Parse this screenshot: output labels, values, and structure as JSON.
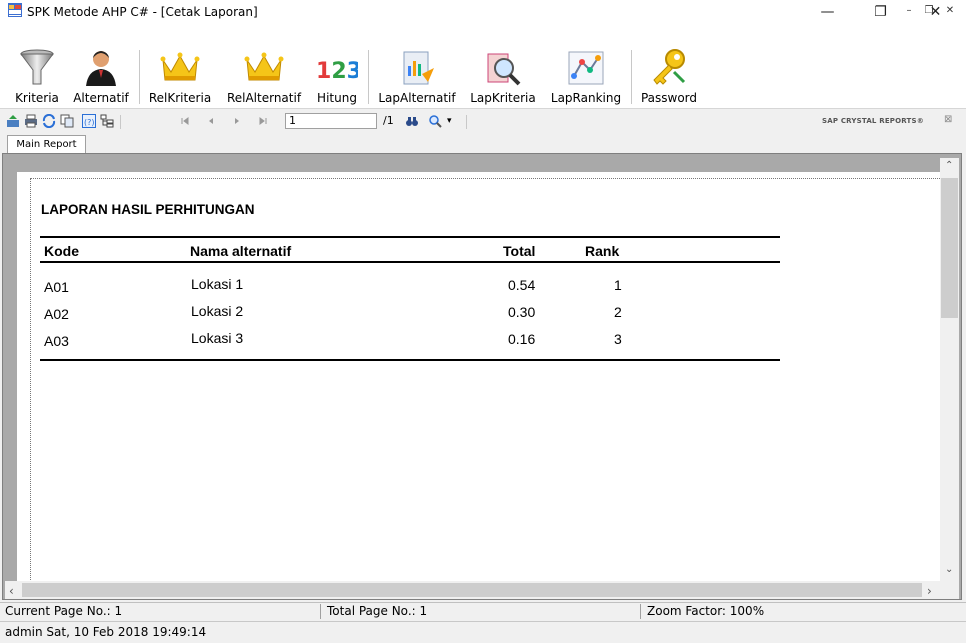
{
  "window": {
    "title": "SPK Metode AHP C# - [Cetak Laporan]"
  },
  "toolbar": {
    "items": [
      {
        "label": "Kriteria"
      },
      {
        "label": "Alternatif"
      },
      {
        "label": "RelKriteria"
      },
      {
        "label": "RelAlternatif"
      },
      {
        "label": "Hitung"
      },
      {
        "label": "LapAlternatif"
      },
      {
        "label": "LapKriteria"
      },
      {
        "label": "LapRanking"
      },
      {
        "label": "Password"
      }
    ],
    "hitung_icon_text": "123"
  },
  "viewer": {
    "page_current": "1",
    "page_total": "/1",
    "brand": "SAP CRYSTAL REPORTS®",
    "tab": "Main Report"
  },
  "report": {
    "title": "LAPORAN HASIL PERHITUNGAN",
    "headers": {
      "kode": "Kode",
      "nama": "Nama alternatif",
      "total": "Total",
      "rank": "Rank"
    },
    "rows": [
      {
        "kode": "A01",
        "nama": "Lokasi 1",
        "total": "0.54",
        "rank": "1"
      },
      {
        "kode": "A02",
        "nama": "Lokasi 2",
        "total": "0.30",
        "rank": "2"
      },
      {
        "kode": "A03",
        "nama": "Lokasi 3",
        "total": "0.16",
        "rank": "3"
      }
    ]
  },
  "status": {
    "current_page": "Current Page No.: 1",
    "total_page": "Total Page No.: 1",
    "zoom": "Zoom Factor: 100%"
  },
  "footer": {
    "user_info": "admin Sat, 10 Feb 2018 19:49:14"
  }
}
